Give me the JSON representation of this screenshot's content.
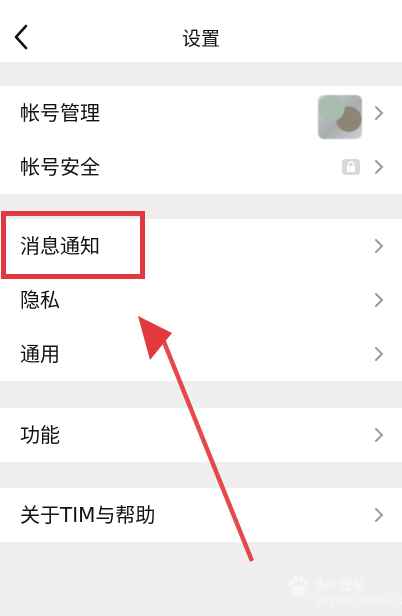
{
  "header": {
    "title": "设置",
    "back_icon": "chevron-left-icon"
  },
  "groups": [
    {
      "items": [
        {
          "label": "帐号管理",
          "accessory": "avatar"
        },
        {
          "label": "帐号安全",
          "accessory": "lock-icon"
        }
      ]
    },
    {
      "items": [
        {
          "label": "消息通知",
          "highlighted": true
        },
        {
          "label": "隐私"
        },
        {
          "label": "通用"
        }
      ]
    },
    {
      "items": [
        {
          "label": "功能"
        }
      ]
    },
    {
      "items": [
        {
          "label": "关于TIM与帮助"
        }
      ]
    }
  ],
  "annotation": {
    "box_color": "#e2393f",
    "arrow_color": "#e2393f"
  },
  "watermark": {
    "text": "Bai 经验",
    "sub": "jingyan.baidu.com"
  }
}
